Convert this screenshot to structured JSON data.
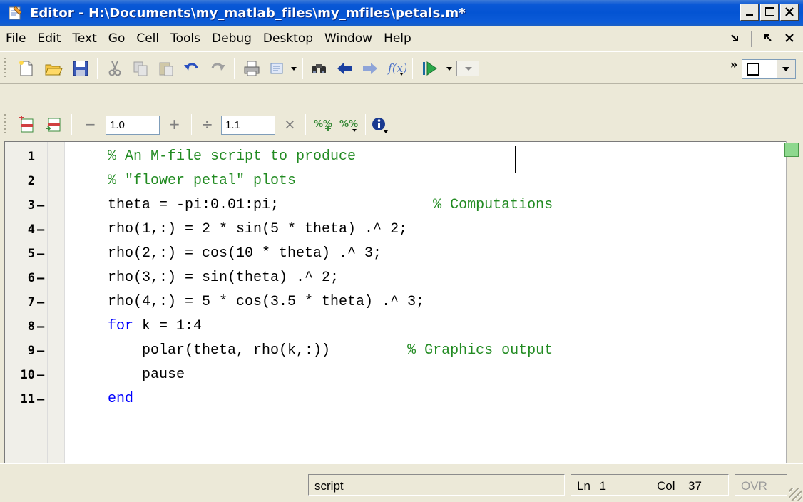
{
  "window": {
    "title": "Editor - H:\\Documents\\my_matlab_files\\my_mfiles\\petals.m*"
  },
  "menu": {
    "items": [
      "File",
      "Edit",
      "Text",
      "Go",
      "Cell",
      "Tools",
      "Debug",
      "Desktop",
      "Window",
      "Help"
    ]
  },
  "toolbar2": {
    "cell_decrement_value": "1.0",
    "cell_divide_value": "1.1",
    "minus_glyph": "−",
    "plus_glyph": "+",
    "divide_glyph": "÷",
    "times_glyph": "×"
  },
  "editor": {
    "lines": [
      {
        "num": "1",
        "exec": false
      },
      {
        "num": "2",
        "exec": false
      },
      {
        "num": "3",
        "exec": true
      },
      {
        "num": "4",
        "exec": true
      },
      {
        "num": "5",
        "exec": true
      },
      {
        "num": "6",
        "exec": true
      },
      {
        "num": "7",
        "exec": true
      },
      {
        "num": "8",
        "exec": true
      },
      {
        "num": "9",
        "exec": true
      },
      {
        "num": "10",
        "exec": true
      },
      {
        "num": "11",
        "exec": true
      }
    ],
    "code": {
      "l1": "% An M-file script to produce",
      "l2": "% \"flower petal\" plots",
      "l3_code": "theta = -pi:0.01:pi;",
      "l3_pad": "                  ",
      "l3_cmt": "% Computations",
      "l4": "rho(1,:) = 2 * sin(5 * theta) .^ 2;",
      "l5": "rho(2,:) = cos(10 * theta) .^ 3;",
      "l6": "rho(3,:) = sin(theta) .^ 2;",
      "l7": "rho(4,:) = 5 * cos(3.5 * theta) .^ 3;",
      "l8_kw": "for",
      "l8_rest": " k = 1:4",
      "l9_code": "    polar(theta, rho(k,:))",
      "l9_pad": "         ",
      "l9_cmt": "% Graphics output",
      "l10": "    pause",
      "l11_kw": "end"
    },
    "dash": "–"
  },
  "status": {
    "mode": "script",
    "ln_label": "Ln",
    "ln_value": "1",
    "col_label": "Col",
    "col_value": "37",
    "ovr": "OVR"
  },
  "colors": {
    "comment": "#228b22",
    "keyword": "#0000ff",
    "titlebar": "#0454d3"
  }
}
